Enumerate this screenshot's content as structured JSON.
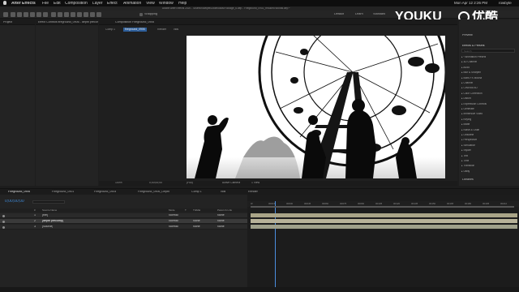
{
  "app": {
    "title": "After Effects",
    "menus": [
      "File",
      "Edit",
      "Composition",
      "Layer",
      "Effect",
      "Animation",
      "View",
      "Window",
      "Help"
    ],
    "document_path": "Adobe After Effects 2020 - /Users/rowbyte/Downloads/Footage_6.aep - Fireground_0902_reduced tutorial.aep *",
    "datetime": "Mon Apr 12  2:26 PM",
    "user": "rowbyte"
  },
  "workspace": {
    "items": [
      "Default",
      "Learn",
      "Standard",
      "Small Screen",
      "Libraries"
    ],
    "snapping_label": "Snapping"
  },
  "project_panel": {
    "tab": "Project"
  },
  "effect_controls": {
    "tab": "Effect Controls fireground_0906 - depth precomp"
  },
  "composition": {
    "tab": "Composition Fireground_0906",
    "breadcrumb": [
      "Comp 1",
      "fireground_0906",
      "Render",
      "vids"
    ],
    "zoom": "100%",
    "timecode": "0;00;00;00",
    "resolution": "(Full)",
    "camera": "Active Camera",
    "views": "1 View"
  },
  "right_panels": {
    "preview": "Preview",
    "effects_title": "Effects & Presets",
    "search_placeholder": "Search",
    "categories": [
      "* Animation Presets",
      "3D Channel",
      "Audio",
      "Blur & Sharpen",
      "Boris FX Mocha",
      "Channel",
      "CINEMA 4D",
      "Color Correction",
      "Distort",
      "Expression Controls",
      "Generate",
      "Immersive Video",
      "Keying",
      "Matte",
      "Noise & Grain",
      "Obsolete",
      "Perspective",
      "Simulation",
      "Stylize",
      "Text",
      "Time",
      "Transition",
      "Utility"
    ],
    "libraries": "Libraries"
  },
  "timeline": {
    "tabs": [
      "Fireground_0906",
      "Fireground_0901",
      "Fireground_0904",
      "Fireground_0906_Depth",
      "Comp 1",
      "vids",
      "Render"
    ],
    "timecode": "0;00;00;00",
    "column_headers": [
      "#",
      "Source Name",
      "Mode",
      "T",
      "TrkMat",
      "Parent & Link"
    ],
    "layers": [
      {
        "num": "1",
        "name": "[fire]",
        "mode": "Normal",
        "trkmat": "",
        "parent": "None"
      },
      {
        "num": "2",
        "name": "[depth precomp]",
        "mode": "Normal",
        "trkmat": "None",
        "parent": "None"
      },
      {
        "num": "3",
        "name": "[Source]",
        "mode": "Normal",
        "trkmat": "None",
        "parent": "None"
      }
    ],
    "ruler_ticks": [
      "0f",
      "00015",
      "00030",
      "00045",
      "00060",
      "00075",
      "00090",
      "00105",
      "00120",
      "00135",
      "00150",
      "00165",
      "00180",
      "00195",
      "00210"
    ]
  },
  "watermark": {
    "brand": "YOUKU",
    "brand_cn": "优酷"
  }
}
